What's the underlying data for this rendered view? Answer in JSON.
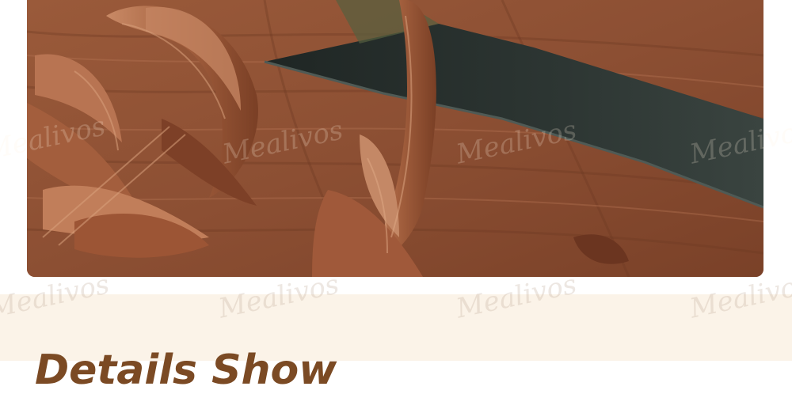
{
  "product_photo": {
    "subject": "wood-shavings-and-carving-knife"
  },
  "watermark": {
    "text": "Mealivos"
  },
  "section": {
    "heading": "Details Show"
  },
  "colors": {
    "page_background": "#ffffff",
    "section_background": "#fbf3e8",
    "heading_color": "#7b4a24",
    "wood": "#8a4a2e",
    "blade": "#2c3431"
  }
}
